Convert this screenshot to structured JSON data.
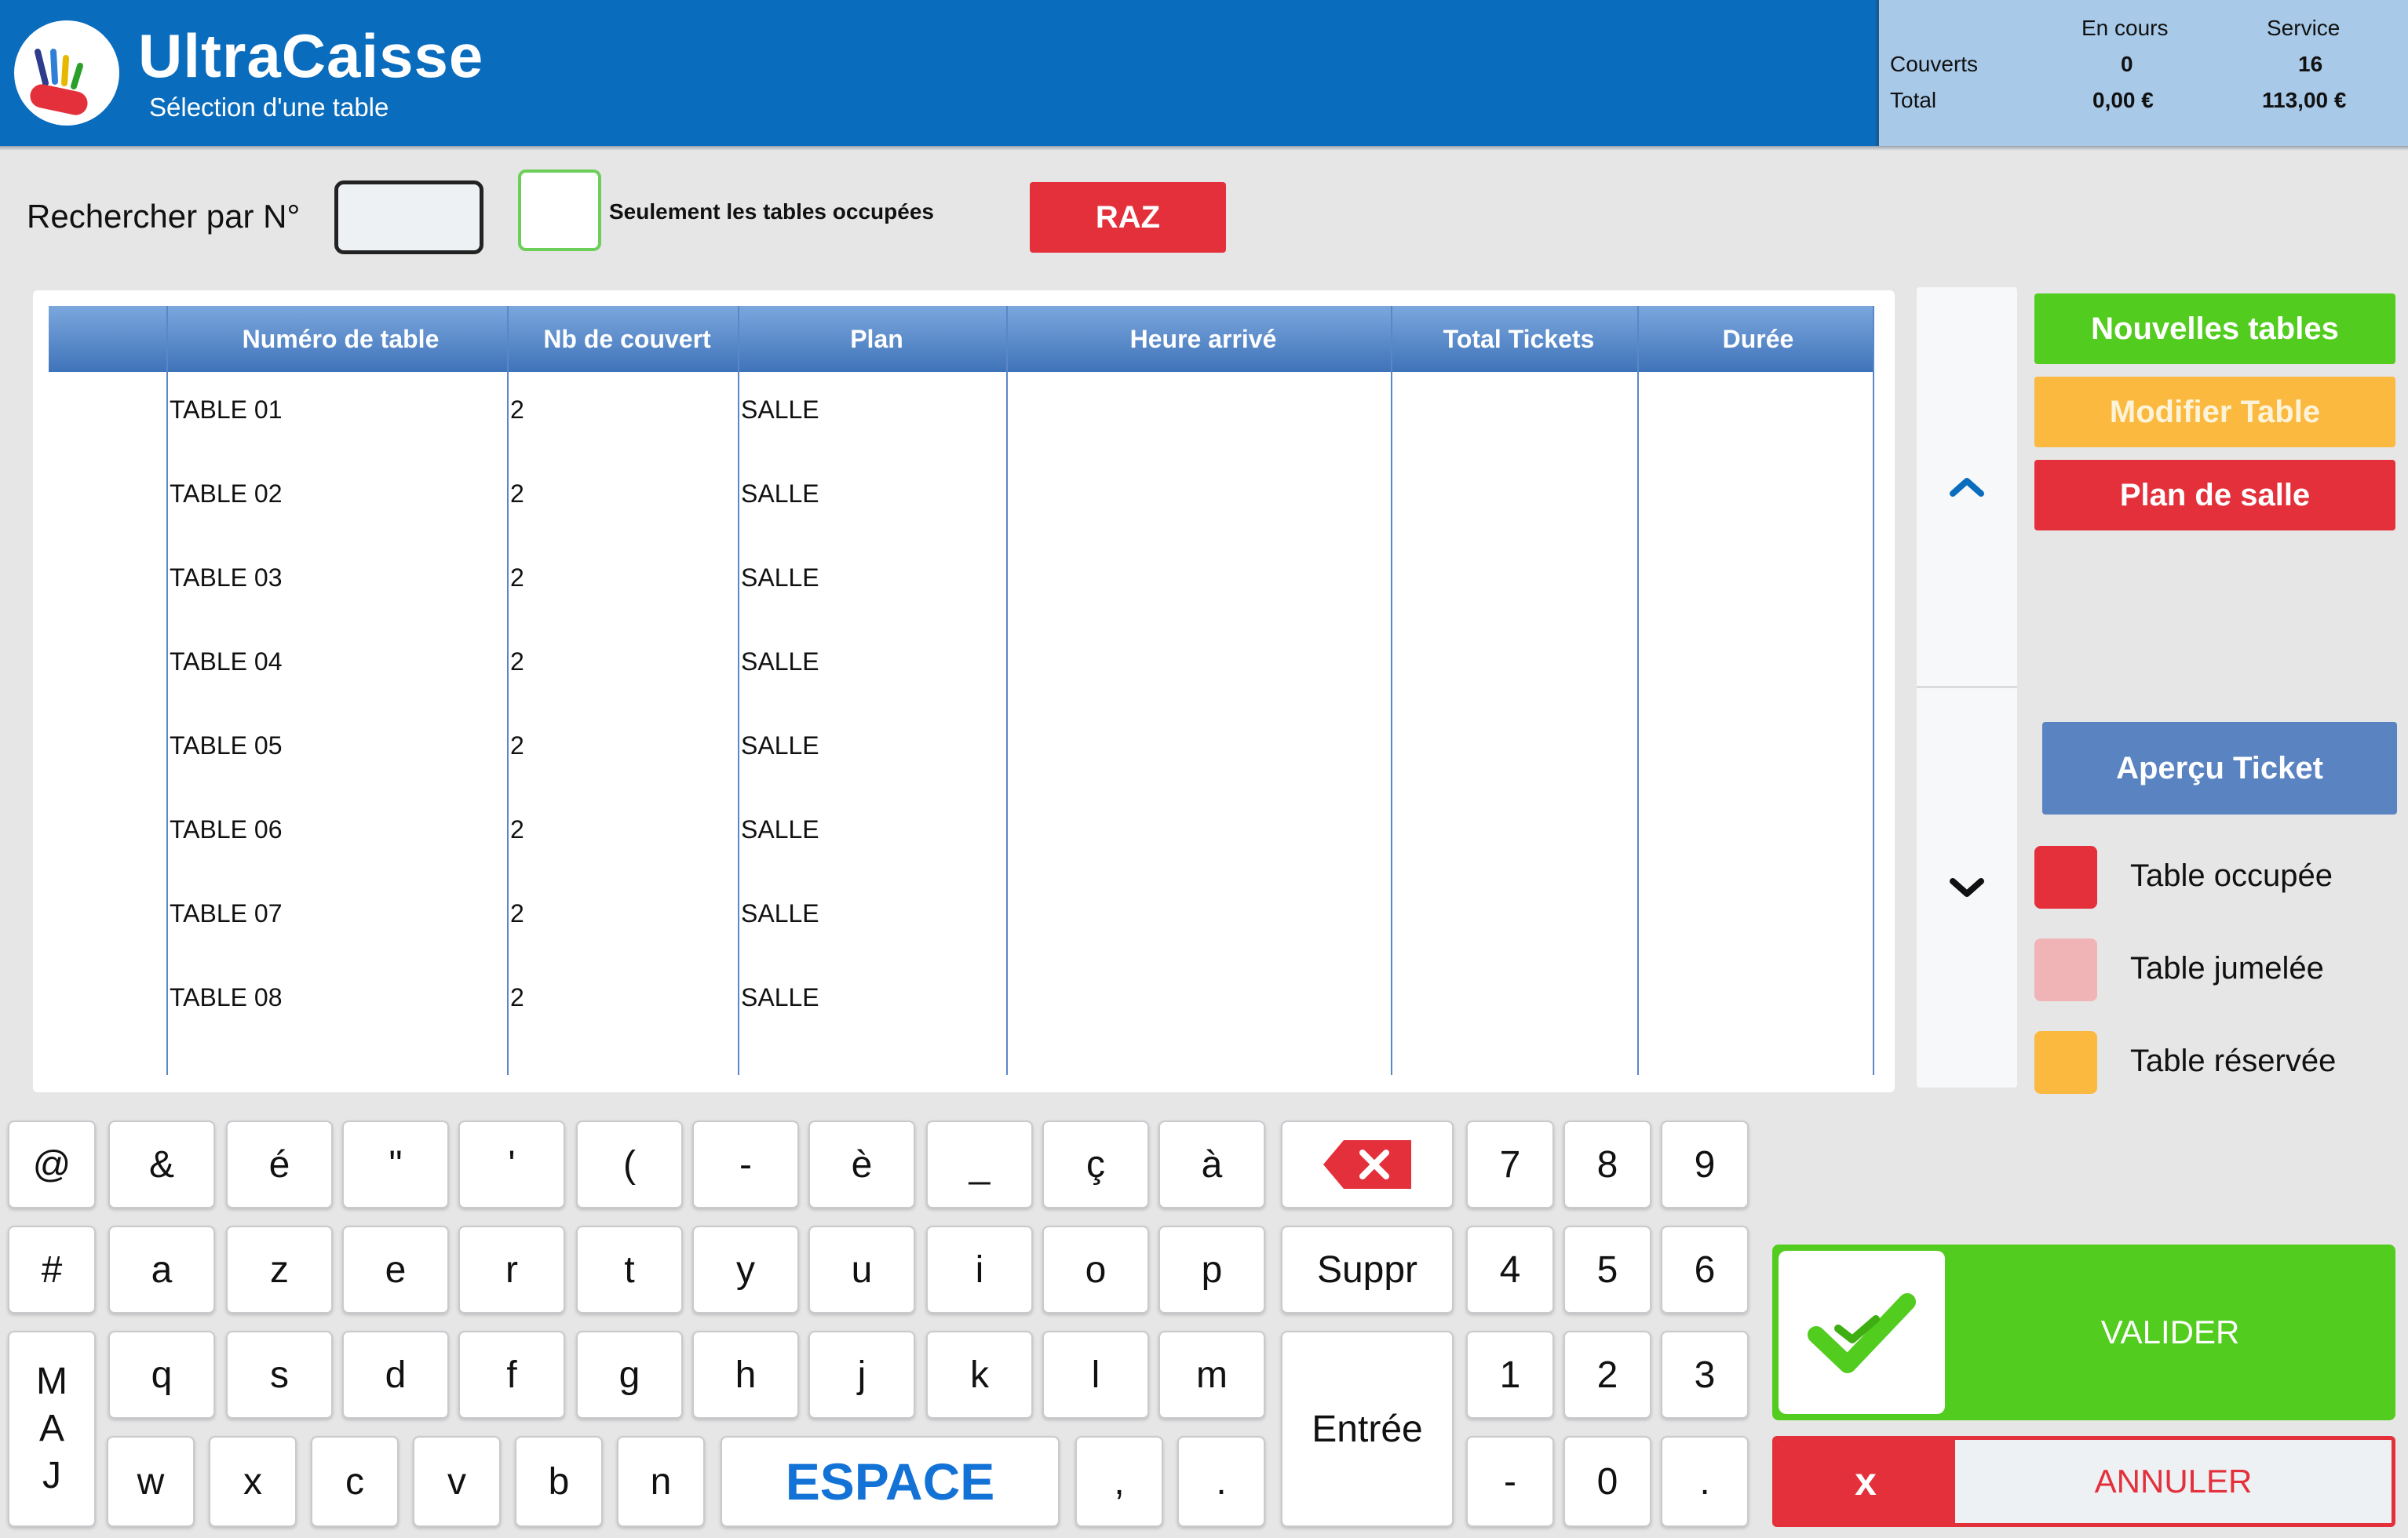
{
  "header": {
    "app_title": "UltraCaisse",
    "subtitle": "Sélection d'une table"
  },
  "stats": {
    "col_en_cours": "En cours",
    "col_service": "Service",
    "couverts_label": "Couverts",
    "total_label": "Total",
    "couverts_en_cours": "0",
    "couverts_service": "16",
    "total_en_cours": "0,00 €",
    "total_service": "113,00 €"
  },
  "search": {
    "label": "Rechercher par N°",
    "value": "",
    "placeholder": "",
    "only_occupied_label": "Seulement les tables occupées",
    "raz_label": "RAZ"
  },
  "table": {
    "columns": [
      "",
      "Numéro de table",
      "Nb de couvert",
      "Plan",
      "Heure arrivé",
      "Total Tickets",
      "Durée"
    ],
    "rows": [
      {
        "numero": "TABLE 01",
        "couverts": "2",
        "plan": "SALLE",
        "heure": "",
        "total": "",
        "duree": ""
      },
      {
        "numero": "TABLE 02",
        "couverts": "2",
        "plan": "SALLE",
        "heure": "",
        "total": "",
        "duree": ""
      },
      {
        "numero": "TABLE 03",
        "couverts": "2",
        "plan": "SALLE",
        "heure": "",
        "total": "",
        "duree": ""
      },
      {
        "numero": "TABLE 04",
        "couverts": "2",
        "plan": "SALLE",
        "heure": "",
        "total": "",
        "duree": ""
      },
      {
        "numero": "TABLE 05",
        "couverts": "2",
        "plan": "SALLE",
        "heure": "",
        "total": "",
        "duree": ""
      },
      {
        "numero": "TABLE 06",
        "couverts": "2",
        "plan": "SALLE",
        "heure": "",
        "total": "",
        "duree": ""
      },
      {
        "numero": "TABLE 07",
        "couverts": "2",
        "plan": "SALLE",
        "heure": "",
        "total": "",
        "duree": ""
      },
      {
        "numero": "TABLE 08",
        "couverts": "2",
        "plan": "SALLE",
        "heure": "",
        "total": "",
        "duree": ""
      }
    ]
  },
  "scroll": {
    "up_icon": "chevron-up-icon",
    "down_icon": "chevron-down-icon"
  },
  "actions": {
    "nouvelles_tables": "Nouvelles tables",
    "modifier_table": "Modifier Table",
    "plan_de_salle": "Plan de salle",
    "apercu_ticket": "Aperçu Ticket"
  },
  "legend": {
    "occupee": "Table occupée",
    "jumelee": "Table jumelée",
    "reservee": "Table réservée"
  },
  "keyboard": {
    "row1": [
      "@",
      "&",
      "é",
      "\"",
      "'",
      "(",
      "-",
      "è",
      "_",
      "ç",
      "à"
    ],
    "row2": [
      "#",
      "a",
      "z",
      "e",
      "r",
      "t",
      "y",
      "u",
      "i",
      "o",
      "p"
    ],
    "row3": [
      "q",
      "s",
      "d",
      "f",
      "g",
      "h",
      "j",
      "k",
      "l",
      "m"
    ],
    "row4": [
      "w",
      "x",
      "c",
      "v",
      "b",
      "n"
    ],
    "space": "ESPACE",
    "comma": ",",
    "period": ".",
    "maj": "MAJ",
    "suppr": "Suppr",
    "entree": "Entrée",
    "backspace_icon": "backspace-icon",
    "numpad": [
      "7",
      "8",
      "9",
      "4",
      "5",
      "6",
      "1",
      "2",
      "3",
      "-",
      "0",
      "."
    ]
  },
  "footer": {
    "valider": "VALIDER",
    "annuler_x": "x",
    "annuler": "ANNULER"
  },
  "colors": {
    "header_blue": "#0a6cbd",
    "stats_bg": "#a8c9e8",
    "green": "#52cc1e",
    "orange": "#fbb93f",
    "red": "#e3303b",
    "pink": "#f0b4b6",
    "apercu_blue": "#5a83c1",
    "space_blue": "#1372d6"
  }
}
